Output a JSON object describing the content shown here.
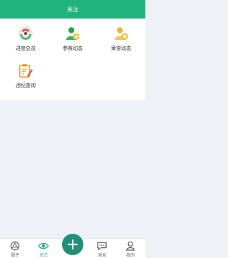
{
  "header": {
    "title": "关注"
  },
  "menu": {
    "items": [
      {
        "label": "进度总览",
        "icon": "progress-overview-icon"
      },
      {
        "label": "参赛动态",
        "icon": "competition-news-icon"
      },
      {
        "label": "荣誉动态",
        "icon": "honor-news-icon"
      },
      {
        "label": "违纪查询",
        "icon": "violation-query-icon"
      }
    ]
  },
  "tabbar": {
    "tabs": [
      {
        "label": "圈子",
        "icon": "circle-icon"
      },
      {
        "label": "关注",
        "icon": "eye-icon",
        "active": true
      },
      {
        "label": "消息",
        "icon": "message-icon"
      },
      {
        "label": "我的",
        "icon": "person-icon"
      }
    ],
    "center_action": {
      "icon": "plus-icon"
    }
  },
  "colors": {
    "primary": "#20b37e",
    "fab": "#1f8f7a",
    "background": "#eef1f5"
  }
}
